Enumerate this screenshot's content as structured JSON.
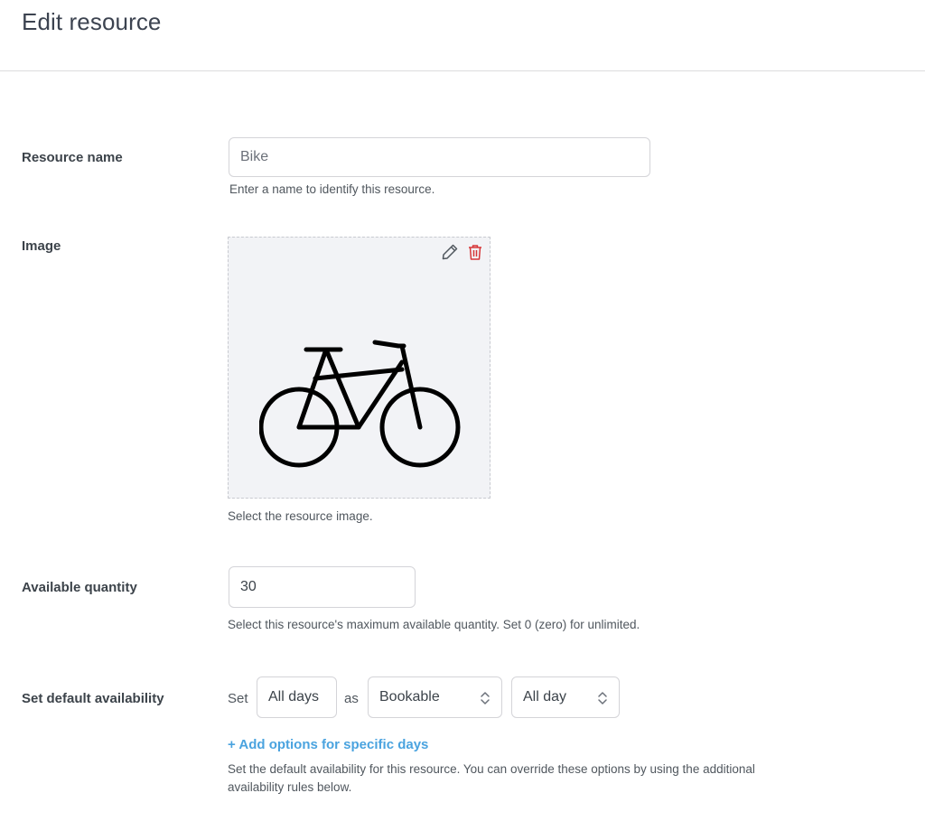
{
  "header": {
    "title": "Edit resource"
  },
  "resource_name": {
    "label": "Resource name",
    "placeholder": "Bike",
    "help": "Enter a name to identify this resource."
  },
  "image": {
    "label": "Image",
    "help": "Select the resource image.",
    "image_icon": "bicycle-icon",
    "edit_icon": "pencil-icon",
    "delete_icon": "trash-icon",
    "delete_color": "#d63638"
  },
  "quantity": {
    "label": "Available quantity",
    "value": "30",
    "help": "Select this resource's maximum available quantity. Set 0 (zero) for unlimited."
  },
  "availability": {
    "label": "Set default availability",
    "set_word": "Set",
    "as_word": "as",
    "days_value": "All days",
    "status_value": "Bookable",
    "time_value": "All day",
    "add_link": "+ Add options for specific days",
    "add_link_color": "#4aa3df",
    "help_line1": "Set the default availability for this resource. You can override these options by using the additional",
    "help_line2": "availability rules below."
  }
}
